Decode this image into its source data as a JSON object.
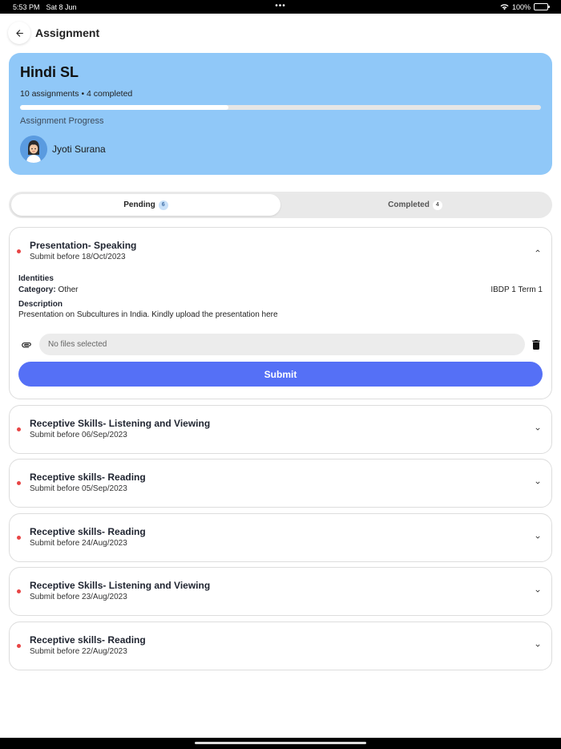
{
  "status_bar": {
    "time": "5:53 PM",
    "date": "Sat 8 Jun",
    "battery": "100%",
    "battery_level": 1.0
  },
  "header": {
    "title": "Assignment"
  },
  "course": {
    "title": "Hindi SL",
    "meta": "10 assignments • 4 completed",
    "progress": 0.4,
    "progress_label": "Assignment Progress",
    "teacher_name": "Jyoti Surana"
  },
  "tabs": [
    {
      "label": "Pending",
      "count": "6",
      "active": true
    },
    {
      "label": "Completed",
      "count": "4",
      "active": false
    }
  ],
  "expanded": {
    "title": "Presentation- Speaking",
    "due": "Submit before 18/Oct/2023",
    "identities_label": "Identities",
    "category_label": "Category:",
    "category_value": "Other",
    "term": "IBDP 1 Term 1",
    "description_label": "Description",
    "description": "Presentation on Subcultures in India. Kindly upload the presentation here",
    "file_placeholder": "No files selected",
    "submit_label": "Submit"
  },
  "assignments": [
    {
      "title": "Receptive Skills- Listening and Viewing",
      "due": "Submit before 06/Sep/2023"
    },
    {
      "title": "Receptive skills- Reading",
      "due": "Submit before 05/Sep/2023"
    },
    {
      "title": "Receptive skills- Reading",
      "due": "Submit before 24/Aug/2023"
    },
    {
      "title": "Receptive Skills- Listening and Viewing",
      "due": "Submit before 23/Aug/2023"
    },
    {
      "title": "Receptive skills- Reading",
      "due": "Submit before 22/Aug/2023"
    }
  ],
  "colors": {
    "card_bg": "#90c8f8",
    "accent": "#5570f6",
    "pending_dot": "#e84545"
  }
}
